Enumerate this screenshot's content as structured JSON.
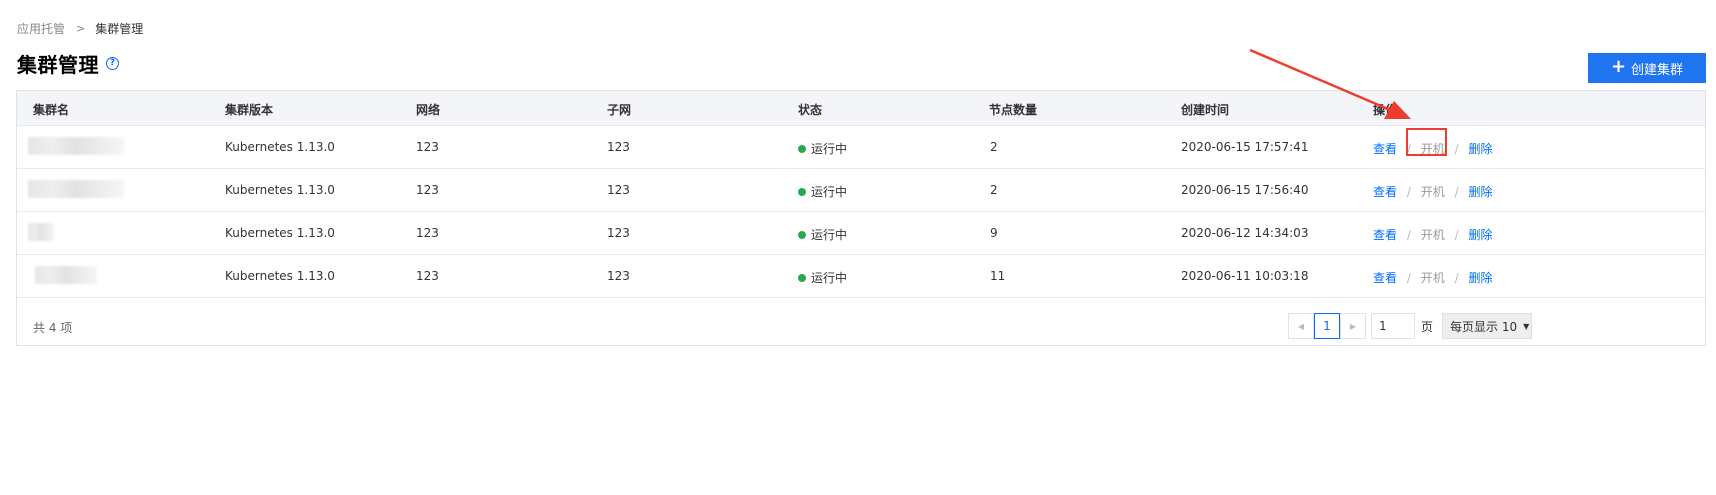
{
  "breadcrumb": {
    "parent": "应用托管",
    "separator": ">",
    "current": "集群管理"
  },
  "page": {
    "title": "集群管理",
    "help_glyph": "?"
  },
  "create_button": {
    "label": "创建集群",
    "icon": "plus-icon"
  },
  "table": {
    "columns": [
      "集群名",
      "集群版本",
      "网络",
      "子网",
      "状态",
      "节点数量",
      "创建时间",
      "操作"
    ],
    "rows": [
      {
        "version": "Kubernetes 1.13.0",
        "network": "123",
        "subnet": "123",
        "status": "运行中",
        "nodes": "2",
        "created": "2020-06-15 17:57:41"
      },
      {
        "version": "Kubernetes 1.13.0",
        "network": "123",
        "subnet": "123",
        "status": "运行中",
        "nodes": "2",
        "created": "2020-06-15 17:56:40"
      },
      {
        "version": "Kubernetes 1.13.0",
        "network": "123",
        "subnet": "123",
        "status": "运行中",
        "nodes": "9",
        "created": "2020-06-12 14:34:03"
      },
      {
        "version": "Kubernetes 1.13.0",
        "network": "123",
        "subnet": "123",
        "status": "运行中",
        "nodes": "11",
        "created": "2020-06-11 10:03:18"
      }
    ],
    "actions": {
      "view": "查看",
      "power_on": "开机",
      "delete": "删除",
      "separator": "/"
    }
  },
  "footer": {
    "total": "共 4 项",
    "current_page": "1",
    "page_input": "1",
    "page_label": "页",
    "page_size": "每页显示 10"
  },
  "colors": {
    "accent": "#006eff",
    "button": "#1f74ef",
    "status_running": "#29a94d",
    "annotation": "#ef3c2c"
  }
}
